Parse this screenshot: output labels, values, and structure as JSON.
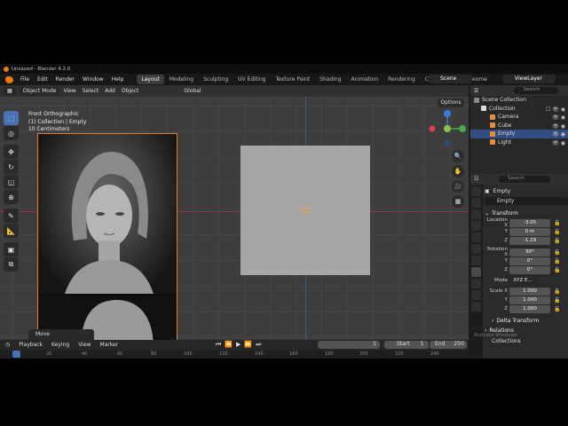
{
  "title": "Unsaved - Blender 4.2.0",
  "menu": [
    "File",
    "Edit",
    "Render",
    "Window",
    "Help"
  ],
  "workspaces": [
    "Layout",
    "Modeling",
    "Sculpting",
    "UV Editing",
    "Texture Paint",
    "Shading",
    "Animation",
    "Rendering",
    "Compositing",
    "Geome"
  ],
  "scene": "Scene",
  "view_layer": "ViewLayer",
  "viewport_header": {
    "mode": "Object Mode",
    "menus": [
      "View",
      "Select",
      "Add",
      "Object"
    ],
    "transform": "Global",
    "options": "Options"
  },
  "overlay": {
    "view": "Front Orthographic",
    "collection": "(1) Collection | Empty",
    "scale": "10 Centimeters"
  },
  "move_panel": "Move",
  "timeline": {
    "menus": [
      "Playback",
      "Keying",
      "View",
      "Marker"
    ],
    "frame": "1",
    "start_label": "Start",
    "start": "1",
    "end_label": "End",
    "end": "250",
    "ruler": [
      "0",
      "20",
      "40",
      "60",
      "80",
      "100",
      "120",
      "140",
      "160",
      "180",
      "200",
      "220",
      "240"
    ]
  },
  "outliner": {
    "search_placeholder": "Search",
    "items": [
      {
        "label": "Scene Collection",
        "color": "#cccccc"
      },
      {
        "label": "Collection",
        "color": "#cccccc"
      },
      {
        "label": "Camera",
        "color": "#e0913a"
      },
      {
        "label": "Cube",
        "color": "#e0913a"
      },
      {
        "label": "Empty",
        "color": "#e0913a"
      },
      {
        "label": "Light",
        "color": "#e0913a"
      }
    ]
  },
  "properties": {
    "search_placeholder": "Search",
    "object_name": "Empty",
    "name_field": "Empty",
    "transform_label": "Transform",
    "location_label": "Location X",
    "y_label": "Y",
    "z_label": "Z",
    "location": [
      "-3.05",
      "0 m",
      "-1.29"
    ],
    "rotation_label": "Rotation X",
    "rotation": [
      "90°",
      "0°",
      "0°"
    ],
    "mode_label": "Mode",
    "mode_value": "XYZ E...",
    "scale_label": "Scale X",
    "scale": [
      "1.000",
      "1.000",
      "1.000"
    ],
    "delta_transform": "Delta Transform",
    "relations": "Relations",
    "collections": "Collections",
    "activate_windows": "Activate Windows"
  }
}
